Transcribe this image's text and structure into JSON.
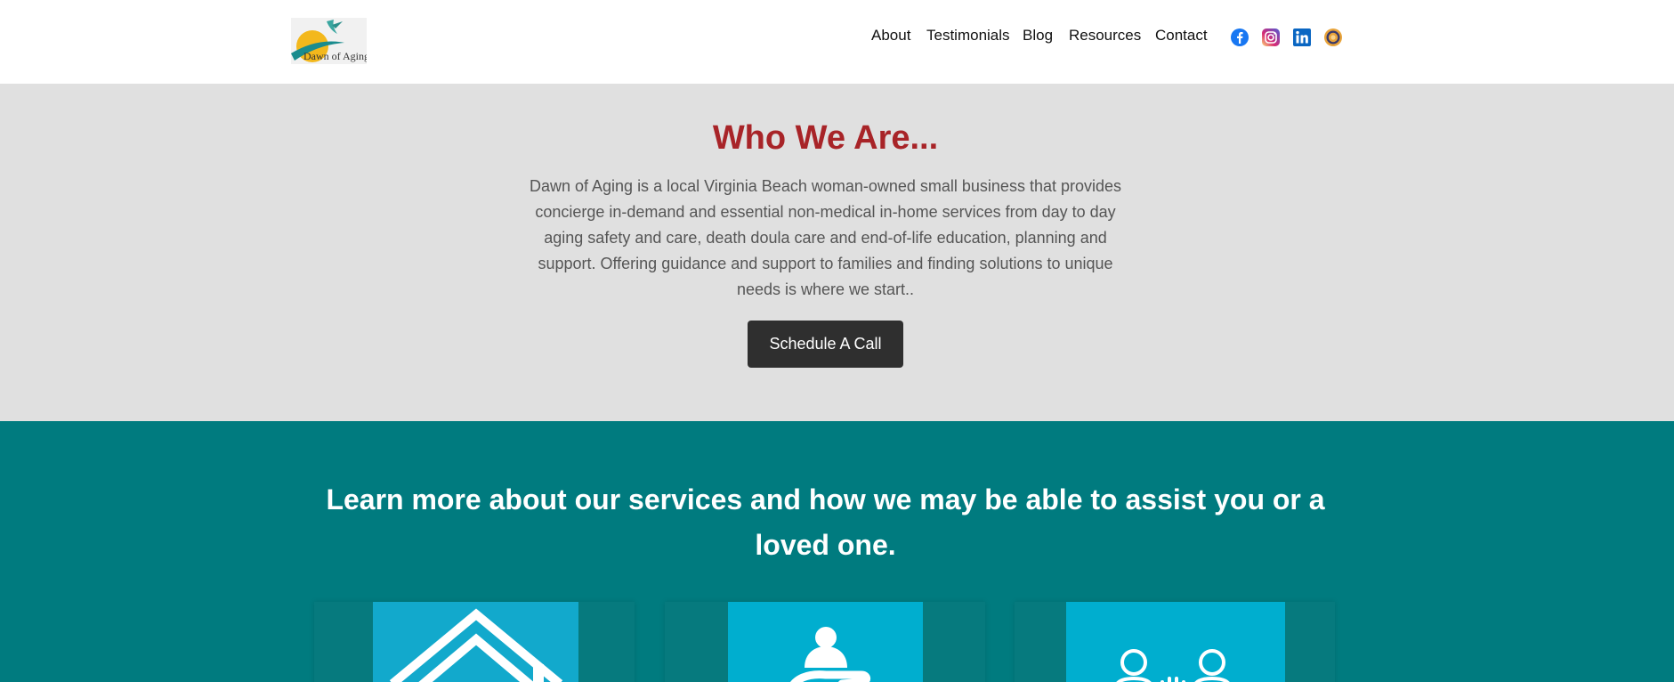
{
  "header": {
    "logo_text": "Dawn of Aging",
    "nav": [
      "About",
      "Testimonials",
      "Blog",
      "Resources",
      "Contact"
    ],
    "social": [
      {
        "name": "facebook-icon",
        "color": "#1877f2"
      },
      {
        "name": "instagram-icon",
        "color": "#d62976"
      },
      {
        "name": "linkedin-icon",
        "color": "#0a66c2"
      },
      {
        "name": "alignable-icon",
        "color": "#e8a33a"
      }
    ]
  },
  "who": {
    "title": "Who We Are...",
    "body": "Dawn of Aging is a local Virginia Beach woman-owned small business that provides concierge in-demand and essential non-medical in-home services from day to day aging safety and care, death doula care and end-of-life education, planning and support. Offering guidance and support to families and finding solutions to unique needs is where we start..",
    "cta_label": "Schedule A Call"
  },
  "services": {
    "heading": "Learn more about our services and how we may be able to assist you or a loved one.",
    "cards": [
      {
        "icon": "house-icon"
      },
      {
        "icon": "caring-hands-icon"
      },
      {
        "icon": "family-icon"
      }
    ]
  },
  "colors": {
    "title_red": "#a82428",
    "section_gray": "#e0e0e0",
    "teal": "#007b7f",
    "card_blue": "#00aecf",
    "button_dark": "#2f2f2f"
  }
}
